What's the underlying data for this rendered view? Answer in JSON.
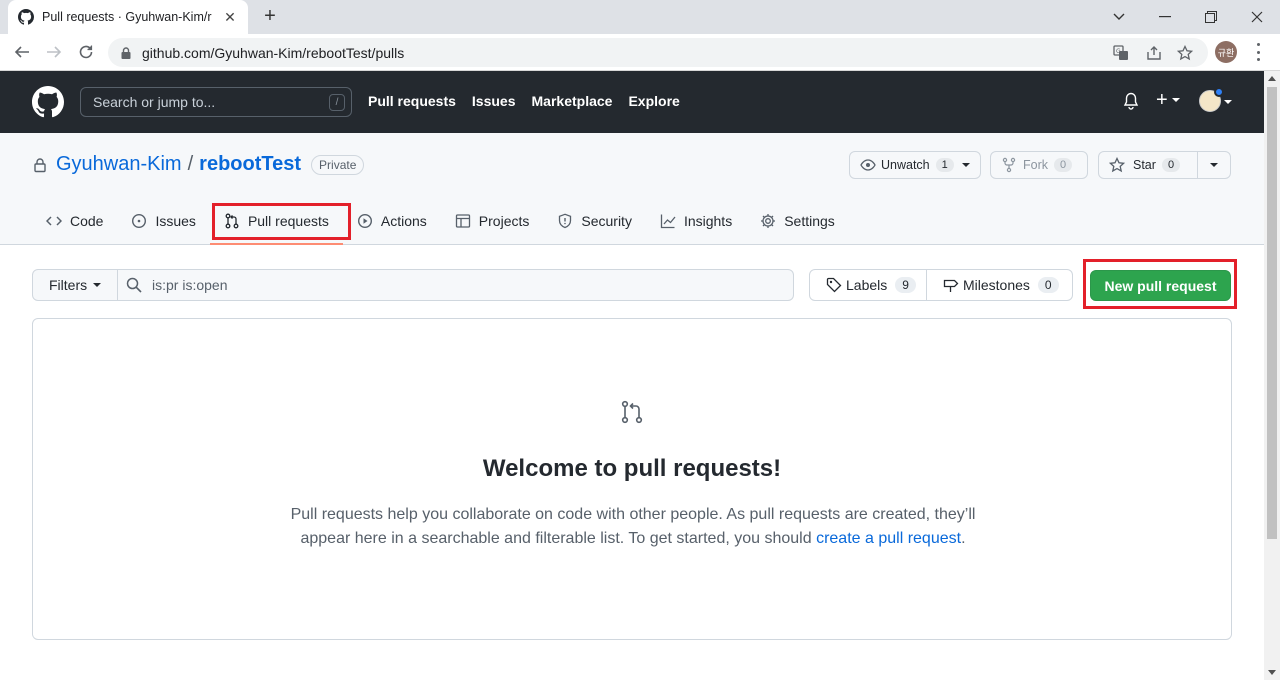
{
  "browser": {
    "tab_title": "Pull requests · Gyuhwan-Kim/rebootTest",
    "tab_close": "✕",
    "new_tab": "+",
    "url": "github.com/Gyuhwan-Kim/rebootTest/pulls",
    "profile_initials": "규환"
  },
  "header": {
    "search_placeholder": "Search or jump to...",
    "search_shortcut": "/",
    "nav": [
      "Pull requests",
      "Issues",
      "Marketplace",
      "Explore"
    ],
    "plus": "+"
  },
  "repo": {
    "owner": "Gyuhwan-Kim",
    "separator": "/",
    "name": "rebootTest",
    "visibility": "Private",
    "watch_label": "Unwatch",
    "watch_count": "1",
    "fork_label": "Fork",
    "fork_count": "0",
    "star_label": "Star",
    "star_count": "0"
  },
  "tabs": [
    {
      "label": "Code",
      "icon": "code-icon"
    },
    {
      "label": "Issues",
      "icon": "issue-icon"
    },
    {
      "label": "Pull requests",
      "icon": "pull-request-icon"
    },
    {
      "label": "Actions",
      "icon": "play-icon"
    },
    {
      "label": "Projects",
      "icon": "table-icon"
    },
    {
      "label": "Security",
      "icon": "shield-icon"
    },
    {
      "label": "Insights",
      "icon": "graph-icon"
    },
    {
      "label": "Settings",
      "icon": "gear-icon"
    }
  ],
  "subnav": {
    "filters": "Filters",
    "query": "is:pr is:open",
    "labels": "Labels",
    "labels_count": "9",
    "milestones": "Milestones",
    "milestones_count": "0",
    "new_pr": "New pull request"
  },
  "blankslate": {
    "title": "Welcome to pull requests!",
    "body": "Pull requests help you collaborate on code with other people. As pull requests are created, they’ll appear here in a searchable and filterable list. To get started, you should ",
    "link": "create a pull request",
    "end": "."
  },
  "colors": {
    "header_bg": "#24292f",
    "link": "#0969da",
    "primary_button": "#2da44e",
    "highlight": "#e3202a"
  }
}
